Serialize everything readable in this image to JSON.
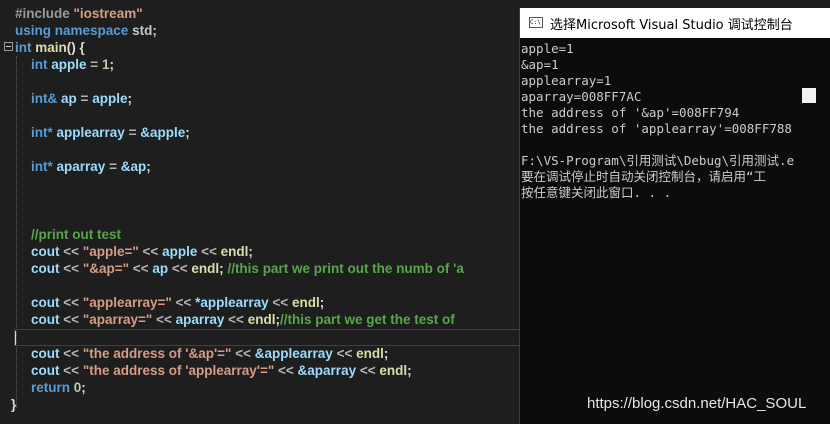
{
  "editor": {
    "lines": {
      "l1": {
        "pp": "#include",
        "str": "\"iostream\""
      },
      "l2": {
        "kw1": "using",
        "kw2": "namespace",
        "ns": "std;"
      },
      "l3": {
        "ty": "int",
        "fn": "main",
        "rest": "() {"
      },
      "l4": {
        "ty": "int",
        "var": "apple",
        "op": "=",
        "num": "1",
        "end": ";"
      },
      "l6": {
        "ty": "int&",
        "var": "ap",
        "op": "=",
        "var2": "apple",
        "end": ";"
      },
      "l8": {
        "ty": "int*",
        "var": "applearray",
        "op": "=",
        "var2": "&apple",
        "end": ";"
      },
      "l10": {
        "ty": "int*",
        "var": "aparray",
        "op": "=",
        "var2": "&ap",
        "end": ";"
      },
      "l14": {
        "cm": "//print out test"
      },
      "l15": {
        "cout": "cout",
        "op1": "<<",
        "str": "\"apple=\"",
        "op2": "<<",
        "var": "apple",
        "op3": "<<",
        "endl": "endl",
        "end": ";"
      },
      "l16": {
        "cout": "cout",
        "op1": "<<",
        "str": "\"&ap=\"",
        "op2": "<<",
        "var": "ap",
        "op3": "<<",
        "endl": "endl",
        "end": ";",
        "cm": "//this part we print out the numb of 'a"
      },
      "l18": {
        "cout": "cout",
        "op1": "<<",
        "str": "\"applearray=\"",
        "op2": "<<",
        "var": "*applearray",
        "op3": "<<",
        "endl": "endl",
        "end": ";"
      },
      "l19": {
        "cout": "cout",
        "op1": "<<",
        "str": "\"aparray=\"",
        "op2": "<<",
        "var": "aparray",
        "op3": "<<",
        "endl": "endl",
        "end": ";",
        "cm": "//this part we get the test of"
      },
      "l21": {
        "cout": "cout",
        "op1": "<<",
        "str": "\"the address of '&ap'=\"",
        "op2": "<<",
        "var": "&applearray",
        "op3": "<<",
        "endl": "endl",
        "end": ";"
      },
      "l22": {
        "cout": "cout",
        "op1": "<<",
        "str": "\"the address of 'applearray'=\"",
        "op2": "<<",
        "var": "&aparray",
        "op3": "<<",
        "endl": "endl",
        "end": ";"
      },
      "l23": {
        "kw": "return",
        "num": "0",
        "end": ";"
      },
      "l24": {
        "brace": "}"
      }
    }
  },
  "console": {
    "title": "选择Microsoft Visual Studio 调试控制台",
    "icon_label": "C:\\",
    "output": [
      "apple=1",
      "&ap=1",
      "applearray=1",
      "aparray=008FF7AC",
      "the address of '&ap'=008FF794",
      "the address of 'applearray'=008FF788",
      "",
      "F:\\VS-Program\\引用测试\\Debug\\引用测试.e",
      "要在调试停止时自动关闭控制台，请启用“工",
      "按任意键关闭此窗口. . ."
    ]
  },
  "watermark": "https://blog.csdn.net/HAC_SOUL",
  "colors": {
    "background": "#1e1e1e",
    "keyword": "#569cd6",
    "string": "#d69d85",
    "function": "#dcdcaa",
    "variable": "#9cdcfe",
    "number": "#b5cea8",
    "comment": "#57a64a",
    "console_bg": "#0c0c0c"
  }
}
